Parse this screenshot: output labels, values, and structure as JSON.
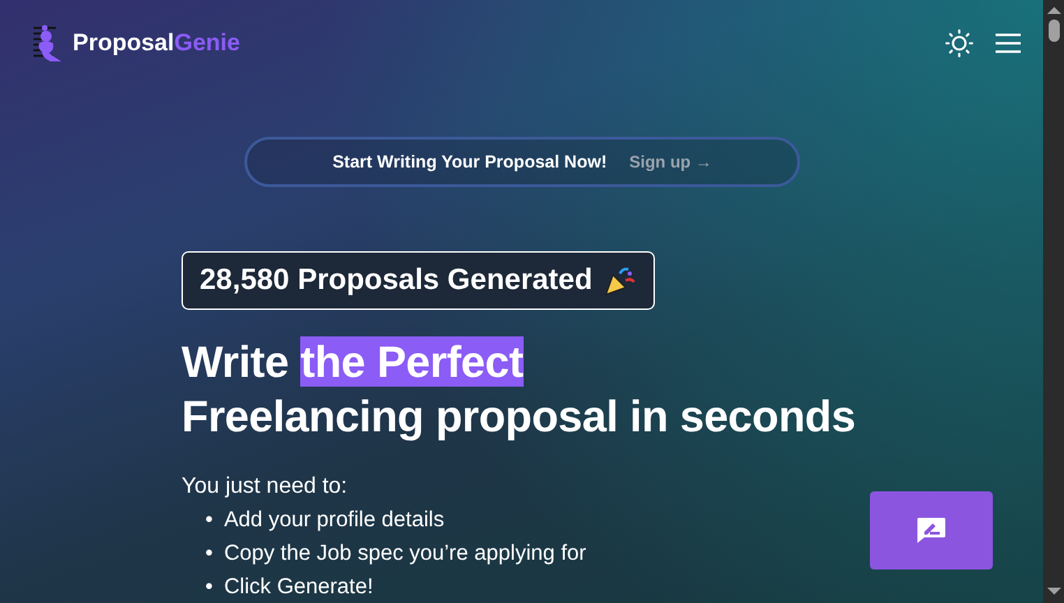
{
  "header": {
    "brand_primary": "Proposal",
    "brand_accent": "Genie"
  },
  "banner": {
    "text": "Start Writing Your Proposal Now!",
    "link": "Sign up →"
  },
  "counter": {
    "text": "28,580 Proposals Generated"
  },
  "headline": {
    "before": "Write",
    "highlight": "the Perfect",
    "line2": "Freelancing proposal in seconds"
  },
  "intro": "You just need to:",
  "steps": [
    {
      "marker": "•",
      "text": "Add your profile details"
    },
    {
      "marker": "•",
      "text": "Copy the Job spec you’re applying for"
    },
    {
      "marker": "•",
      "text": "Click Generate!"
    }
  ]
}
